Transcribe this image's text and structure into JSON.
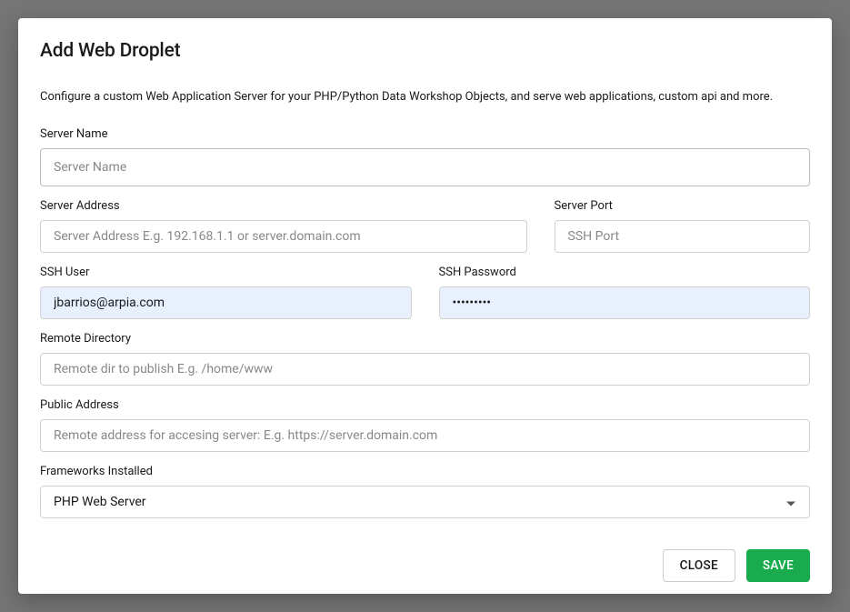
{
  "modal": {
    "title": "Add Web Droplet",
    "description": "Configure a custom Web Application Server for your PHP/Python Data Workshop Objects, and serve web applications, custom api and more."
  },
  "fields": {
    "server_name": {
      "label": "Server Name",
      "placeholder": "Server Name",
      "value": ""
    },
    "server_address": {
      "label": "Server Address",
      "placeholder": "Server Address E.g. 192.168.1.1 or server.domain.com",
      "value": ""
    },
    "server_port": {
      "label": "Server Port",
      "placeholder": "SSH Port",
      "value": ""
    },
    "ssh_user": {
      "label": "SSH User",
      "placeholder": "",
      "value": "jbarrios@arpia.com"
    },
    "ssh_password": {
      "label": "SSH Password",
      "placeholder": "",
      "value": "•••••••••"
    },
    "remote_directory": {
      "label": "Remote Directory",
      "placeholder": "Remote dir to publish E.g. /home/www",
      "value": ""
    },
    "public_address": {
      "label": "Public Address",
      "placeholder": "Remote address for accesing server: E.g. https://server.domain.com",
      "value": ""
    },
    "frameworks": {
      "label": "Frameworks Installed",
      "selected": "PHP Web Server"
    }
  },
  "buttons": {
    "close": "CLOSE",
    "save": "SAVE"
  }
}
